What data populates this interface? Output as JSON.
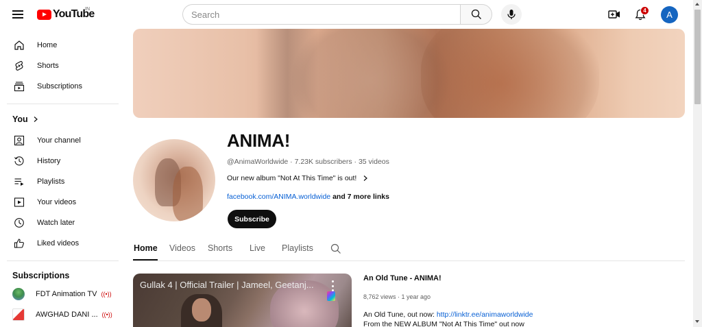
{
  "header": {
    "logo_text": "YouTube",
    "region": "IN",
    "search_placeholder": "Search",
    "notification_count": "4",
    "avatar_letter": "A"
  },
  "sidebar": {
    "main": [
      {
        "label": "Home",
        "icon": "home-icon"
      },
      {
        "label": "Shorts",
        "icon": "shorts-icon"
      },
      {
        "label": "Subscriptions",
        "icon": "subscriptions-icon"
      }
    ],
    "you_heading": "You",
    "you_items": [
      {
        "label": "Your channel",
        "icon": "your-channel-icon"
      },
      {
        "label": "History",
        "icon": "history-icon"
      },
      {
        "label": "Playlists",
        "icon": "playlists-icon"
      },
      {
        "label": "Your videos",
        "icon": "your-videos-icon"
      },
      {
        "label": "Watch later",
        "icon": "watch-later-icon"
      },
      {
        "label": "Liked videos",
        "icon": "liked-videos-icon"
      }
    ],
    "subscriptions_heading": "Subscriptions",
    "subscriptions": [
      {
        "label": "FDT Animation TV",
        "live": true
      },
      {
        "label": "AWGHAD DANI ...",
        "live": true
      }
    ]
  },
  "channel": {
    "name": "ANIMA!",
    "meta": "@AnimaWorldwide · 7.23K subscribers · 35 videos",
    "description": "Our new album \"Not At This Time\" is out!",
    "link": "facebook.com/ANIMA.worldwide",
    "more_links": "and 7 more links",
    "subscribe_label": "Subscribe"
  },
  "tabs": [
    {
      "label": "Home",
      "active": true
    },
    {
      "label": "Videos",
      "active": false
    },
    {
      "label": "Shorts",
      "active": false
    },
    {
      "label": "Live",
      "active": false
    },
    {
      "label": "Playlists",
      "active": false
    }
  ],
  "featured_video": {
    "thumbnail_title": "Gullak 4 | Official Trailer | Jameel, Geetanj...",
    "title": "An Old Tune - ANIMA!",
    "meta": "8,762 views · 1 year ago",
    "desc_prefix": "An Old Tune, out now: ",
    "desc_link": "http://linktr.ee/animaworldwide",
    "desc_line2": "From the NEW ALBUM \"Not At This Time\" out now"
  },
  "colors": {
    "brand_red": "#ff0000",
    "link_blue": "#065fd4",
    "avatar_blue": "#1565c0",
    "text_primary": "#0f0f0f",
    "text_secondary": "#606060"
  }
}
